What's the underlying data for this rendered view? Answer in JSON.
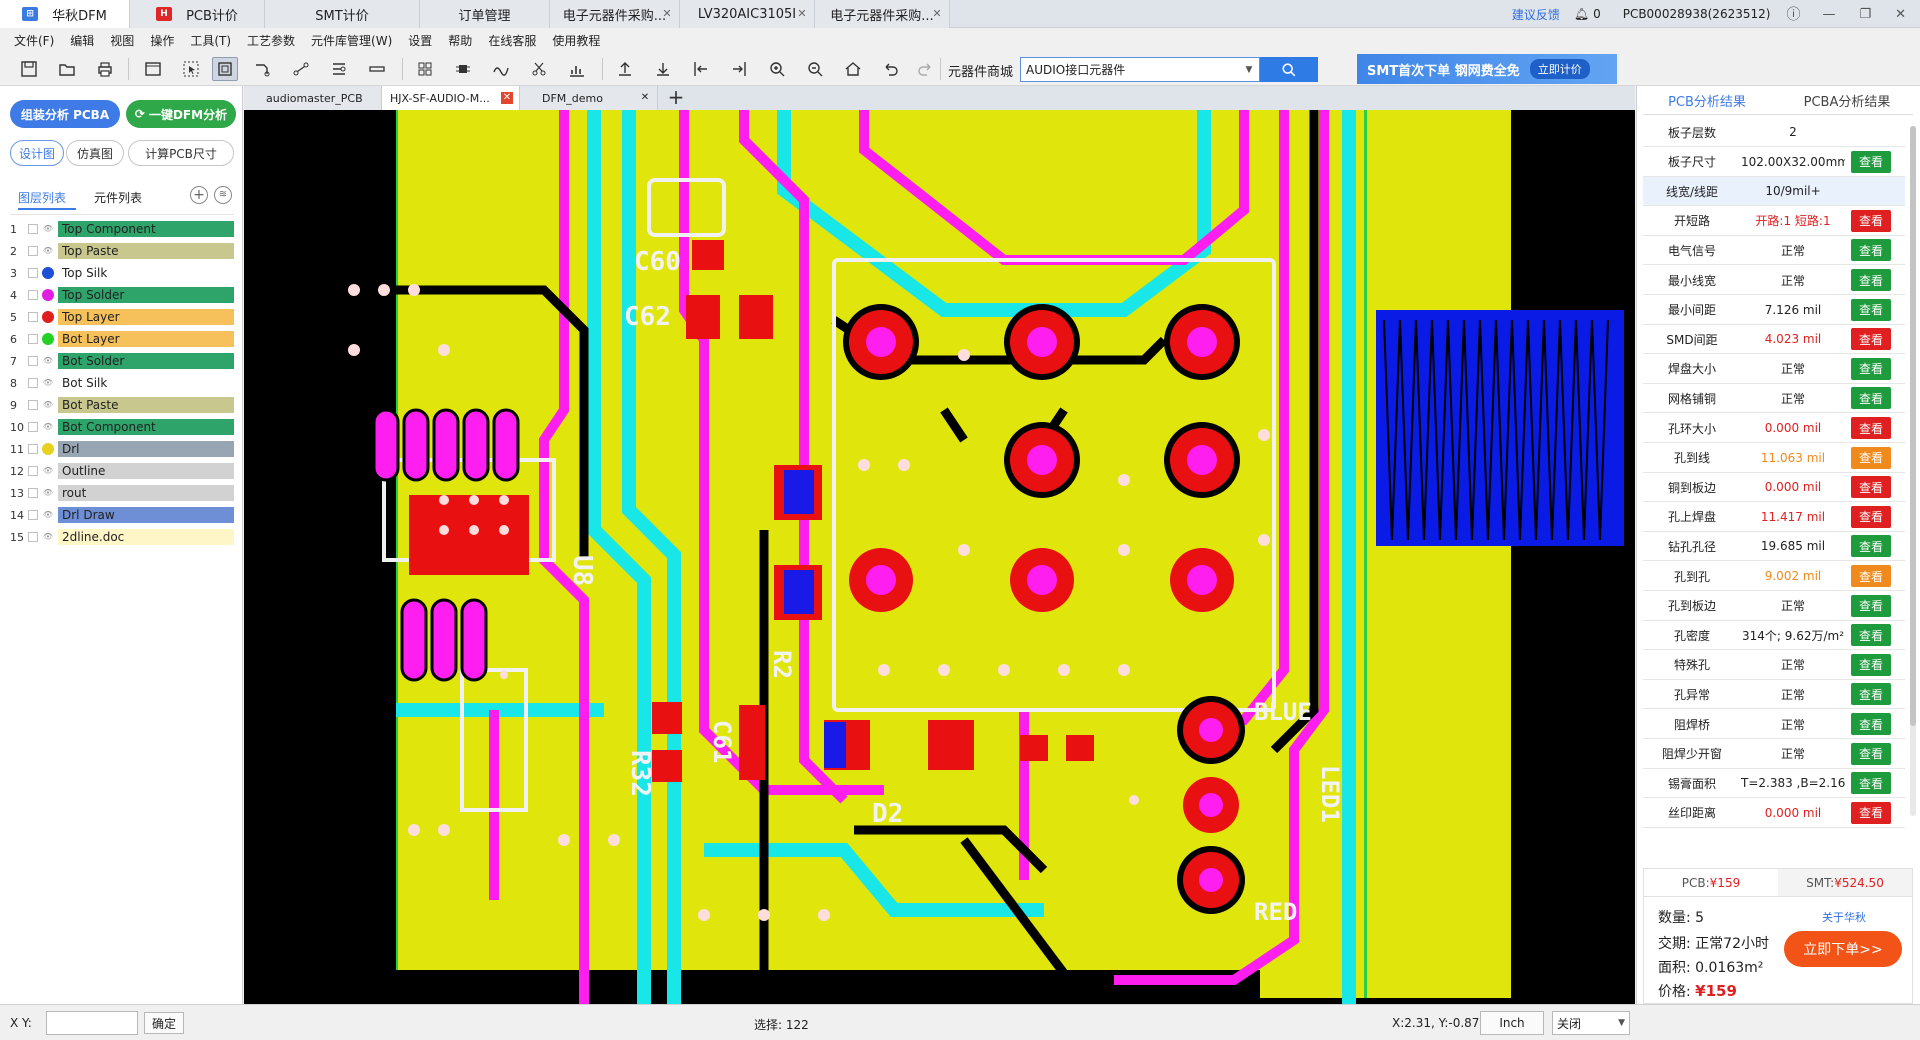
{
  "window_tabs": [
    {
      "label": "华秋DFM",
      "icon_color": "#3a7be0",
      "icon_text": "⊞"
    },
    {
      "label": "PCB计价",
      "icon_color": "#e02727",
      "icon_text": "H"
    },
    {
      "label": "SMT计价"
    },
    {
      "label": "订单管理"
    },
    {
      "label": "电子元器件采购..."
    },
    {
      "label": "LV320AIC3105I"
    },
    {
      "label": "电子元器件采购..."
    }
  ],
  "titlebar_right": {
    "feedback": "建议反馈",
    "notif_count": "0",
    "user": "PCB00028938(2623512)"
  },
  "menu": [
    "文件(F)",
    "编辑",
    "视图",
    "操作",
    "工具(T)",
    "工艺参数",
    "元件库管理(W)",
    "设置",
    "帮助",
    "在线客服",
    "使用教程"
  ],
  "search": {
    "label": "元器件商城",
    "value": "AUDIO接口元器件"
  },
  "banner": {
    "text": "SMT首次下单 钢网费全免",
    "button": "立即计价"
  },
  "left": {
    "btn_pcba": "组装分析 PCBA",
    "btn_dfm": "一键DFM分析",
    "seg": [
      "设计图",
      "仿真图",
      "计算PCB尺寸"
    ],
    "tabs": [
      "图层列表",
      "元件列表"
    ],
    "layers": [
      {
        "n": "1",
        "name": "Top Component",
        "color": "#2ea36a",
        "dot": "eye"
      },
      {
        "n": "2",
        "name": "Top Paste",
        "color": "#c8c88e",
        "dot": "eye"
      },
      {
        "n": "3",
        "name": "Top Silk",
        "color": "#ffffff",
        "dot": "#1f4fd6"
      },
      {
        "n": "4",
        "name": "Top Solder",
        "color": "#2ea36a",
        "dot": "#e020e0"
      },
      {
        "n": "5",
        "name": "Top Layer",
        "color": "#f6c15a",
        "dot": "#e01e1e"
      },
      {
        "n": "6",
        "name": "Bot Layer",
        "color": "#f6c15a",
        "dot": "#25d025"
      },
      {
        "n": "7",
        "name": "Bot Solder",
        "color": "#2ea36a",
        "dot": "eye"
      },
      {
        "n": "8",
        "name": "Bot Silk",
        "color": "#ffffff",
        "dot": "eye"
      },
      {
        "n": "9",
        "name": "Bot Paste",
        "color": "#c8c88e",
        "dot": "eye"
      },
      {
        "n": "10",
        "name": "Bot Component",
        "color": "#2ea36a",
        "dot": "eye"
      },
      {
        "n": "11",
        "name": "Drl",
        "color": "#98a6b4",
        "dot": "#e8d020"
      },
      {
        "n": "12",
        "name": "Outline",
        "color": "#d2d2d2",
        "dot": "eye"
      },
      {
        "n": "13",
        "name": "rout",
        "color": "#d2d2d2",
        "dot": "eye"
      },
      {
        "n": "14",
        "name": "Drl Draw",
        "color": "#6e8ed6",
        "dot": "eye"
      },
      {
        "n": "15",
        "name": "2dline.doc",
        "color": "#fff6c8",
        "dot": "eye"
      }
    ]
  },
  "doc_tabs": [
    {
      "label": "audiomaster_PCB"
    },
    {
      "label": "HJX-SF-AUDIO-M..."
    },
    {
      "label": "DFM_demo"
    }
  ],
  "pcb_labels": [
    "C60",
    "C62",
    "U8",
    "R32",
    "C61",
    "R2",
    "D2",
    "LED1",
    "BLUE",
    "RED"
  ],
  "right": {
    "tabs": [
      "PCB分析结果",
      "PCBA分析结果"
    ],
    "rows": [
      {
        "label": "板子层数",
        "value": "2",
        "btn": "",
        "vcolor": "#222"
      },
      {
        "label": "板子尺寸",
        "value": "102.00X32.00mm",
        "btn": "g",
        "vcolor": "#222"
      },
      {
        "label": "线宽/线距",
        "value": "10/9mil+",
        "btn": "",
        "vcolor": "#222",
        "hl": true
      },
      {
        "label": "开短路",
        "value": "开路:1 短路:1",
        "btn": "r",
        "vcolor": "#e02020"
      },
      {
        "label": "电气信号",
        "value": "正常",
        "btn": "g",
        "vcolor": "#222"
      },
      {
        "label": "最小线宽",
        "value": "正常",
        "btn": "g",
        "vcolor": "#222"
      },
      {
        "label": "最小间距",
        "value": "7.126 mil",
        "btn": "g",
        "vcolor": "#222"
      },
      {
        "label": "SMD间距",
        "value": "4.023 mil",
        "btn": "r",
        "vcolor": "#e02020"
      },
      {
        "label": "焊盘大小",
        "value": "正常",
        "btn": "g",
        "vcolor": "#222"
      },
      {
        "label": "网格铺铜",
        "value": "正常",
        "btn": "g",
        "vcolor": "#222"
      },
      {
        "label": "孔环大小",
        "value": "0.000 mil",
        "btn": "r",
        "vcolor": "#e02020"
      },
      {
        "label": "孔到线",
        "value": "11.063 mil",
        "btn": "o",
        "vcolor": "#f08a1c"
      },
      {
        "label": "铜到板边",
        "value": "0.000 mil",
        "btn": "r",
        "vcolor": "#e02020"
      },
      {
        "label": "孔上焊盘",
        "value": "11.417 mil",
        "btn": "r",
        "vcolor": "#e02020"
      },
      {
        "label": "钻孔孔径",
        "value": "19.685 mil",
        "btn": "g",
        "vcolor": "#222"
      },
      {
        "label": "孔到孔",
        "value": "9.002 mil",
        "btn": "o",
        "vcolor": "#f08a1c"
      },
      {
        "label": "孔到板边",
        "value": "正常",
        "btn": "g",
        "vcolor": "#222"
      },
      {
        "label": "孔密度",
        "value": "314个; 9.62万/m²",
        "btn": "g",
        "vcolor": "#222"
      },
      {
        "label": "特殊孔",
        "value": "正常",
        "btn": "g",
        "vcolor": "#222"
      },
      {
        "label": "孔异常",
        "value": "正常",
        "btn": "g",
        "vcolor": "#222"
      },
      {
        "label": "阻焊桥",
        "value": "正常",
        "btn": "g",
        "vcolor": "#222"
      },
      {
        "label": "阻焊少开窗",
        "value": "正常",
        "btn": "g",
        "vcolor": "#222"
      },
      {
        "label": "锡膏面积",
        "value": "T=2.383 ,B=2.163",
        "btn": "g",
        "vcolor": "#222"
      },
      {
        "label": "丝印距离",
        "value": "0.000 mil",
        "btn": "r",
        "vcolor": "#e02020"
      }
    ],
    "view_label": "查看",
    "order": {
      "pcb_tab": "PCB:",
      "pcb_price": "¥159",
      "smt_tab": "SMT:",
      "smt_price": "¥524.50",
      "qty_label": "数量:",
      "qty": "5",
      "about": "关于华秋",
      "lead_label": "交期:",
      "lead": "正常72小时",
      "area_label": "面积:",
      "area": "0.0163m²",
      "price_label": "价格:",
      "price": "¥159",
      "order_btn": "立即下单>>"
    }
  },
  "status": {
    "xy_label": "X Y:",
    "confirm": "确定",
    "selection": "选择: 122",
    "coords": "X:2.31, Y:-0.87",
    "unit": "Inch",
    "close": "关闭"
  }
}
